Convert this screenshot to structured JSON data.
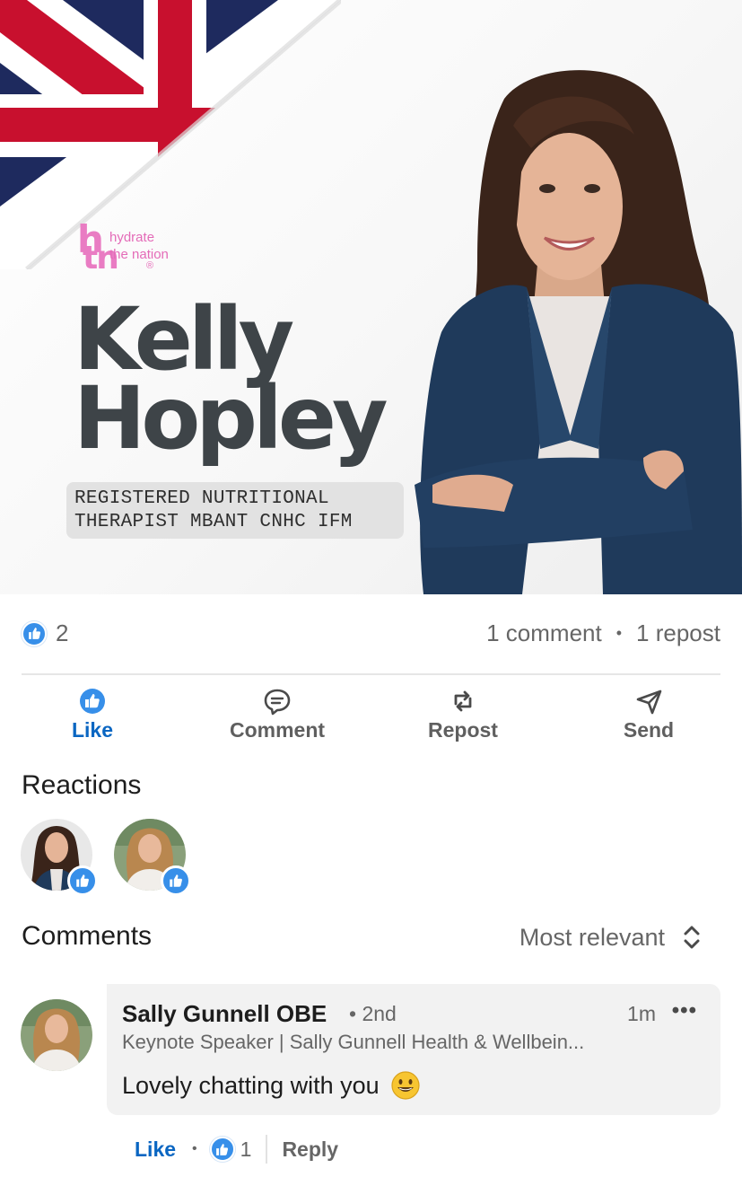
{
  "post": {
    "logo": {
      "h": "h",
      "tn": "tn",
      "line1": "hydrate",
      "line2": "the nation",
      "registered": "®"
    },
    "headline_first": "Kelly",
    "headline_last": "Hopley",
    "credential_line1": "REGISTERED NUTRITIONAL",
    "credential_line2": "THERAPIST MBANT CNHC IFM"
  },
  "social_counts": {
    "reactions": "2",
    "comments": "1 comment",
    "separator": "•",
    "reposts": "1 repost"
  },
  "actions": {
    "like": "Like",
    "comment": "Comment",
    "repost": "Repost",
    "send": "Send"
  },
  "reactions": {
    "title": "Reactions"
  },
  "comments": {
    "title": "Comments",
    "sort_label": "Most relevant",
    "items": [
      {
        "author": "Sally Gunnell OBE",
        "degree": "• 2nd",
        "time": "1m",
        "more": "•••",
        "headline": "Keynote Speaker | Sally Gunnell Health & Wellbein...",
        "text": "Lovely chatting with you",
        "like_label": "Like",
        "dot": "•",
        "like_count": "1",
        "reply_label": "Reply"
      }
    ]
  },
  "colors": {
    "accent": "#0a66c2",
    "like_bubble": "#378fe9",
    "logo_pink": "#e97cc3",
    "headline_grey": "#3e4448",
    "blazer": "#1f3a5b"
  },
  "icons": [
    "like-icon",
    "comment-icon",
    "repost-icon",
    "send-icon",
    "sort-icon",
    "smile-emoji-icon",
    "union-flag"
  ]
}
